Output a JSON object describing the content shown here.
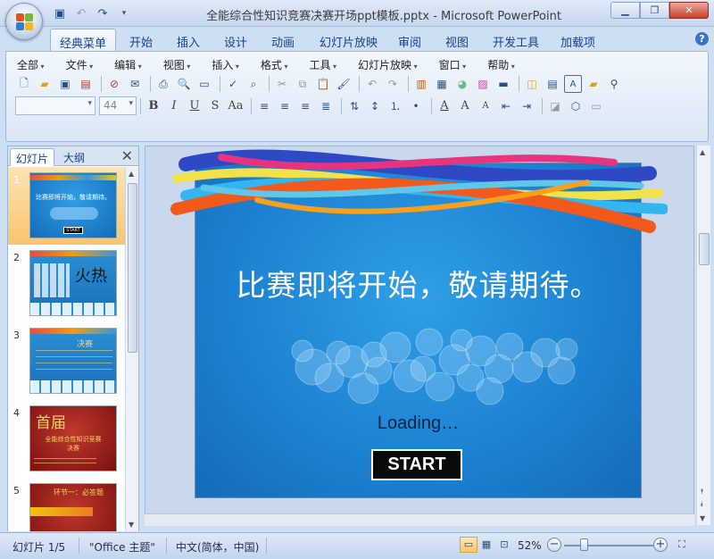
{
  "window": {
    "title": "全能综合性知识竞赛决赛开场ppt模板.pptx - Microsoft PowerPoint",
    "controls": [
      "minimize",
      "maximize",
      "close"
    ]
  },
  "ribbon_tabs": [
    "经典菜单",
    "开始",
    "插入",
    "设计",
    "动画",
    "幻灯片放映",
    "审阅",
    "视图",
    "开发工具",
    "加载项"
  ],
  "active_tab": "经典菜单",
  "classic_menu": [
    "全部",
    "文件",
    "编辑",
    "视图",
    "插入",
    "格式",
    "工具",
    "幻灯片放映",
    "窗口",
    "帮助"
  ],
  "format_bar": {
    "font_name": "",
    "font_size": "44"
  },
  "left_pane": {
    "tabs": [
      "幻灯片",
      "大纲"
    ],
    "active_tab": "幻灯片",
    "slides": [
      {
        "num": "1",
        "caption": "比赛即将开始，敬请期待。",
        "button": "START"
      },
      {
        "num": "2",
        "caption": "火热"
      },
      {
        "num": "3",
        "caption": "决赛"
      },
      {
        "num": "4",
        "caption": "首届",
        "sub": "全能综合性知识竞赛",
        "sub2": "决赛"
      },
      {
        "num": "5",
        "caption": "环节一：必答题"
      }
    ]
  },
  "slide": {
    "title": "比赛即将开始，敬请期待。",
    "loading": "Loading…",
    "button": "START"
  },
  "status": {
    "slide_info": "幻灯片 1/5",
    "theme": "\"Office 主题\"",
    "language": "中文(简体，中国)",
    "zoom": "52%"
  }
}
